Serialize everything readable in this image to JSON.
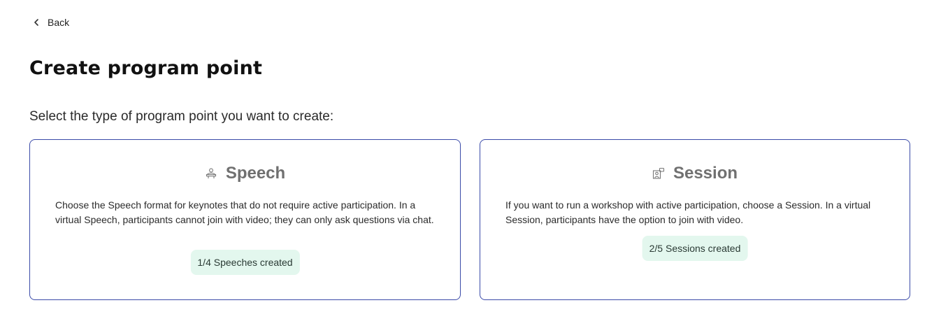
{
  "nav": {
    "back_label": "Back",
    "back_icon": "chevron-left-icon"
  },
  "page": {
    "title": "Create program point",
    "subtitle": "Select the type of program point you want to create:"
  },
  "cards": [
    {
      "id": "speech",
      "title": "Speech",
      "icon": "speaker-podium-icon",
      "description": "Choose the Speech format for keynotes that do not require active participation. In a virtual Speech, participants cannot join with video; they can only ask questions via chat.",
      "badge": "1/4 Speeches created"
    },
    {
      "id": "session",
      "title": "Session",
      "icon": "session-video-icon",
      "description": "If you want to run a workshop with active participation, choose a Session. In a virtual Session, participants have the option to join with video.",
      "badge": "2/5 Sessions created"
    }
  ],
  "colors": {
    "card_border": "#3a4aa8",
    "badge_bg": "#e3f7ee",
    "card_title": "#707070"
  }
}
